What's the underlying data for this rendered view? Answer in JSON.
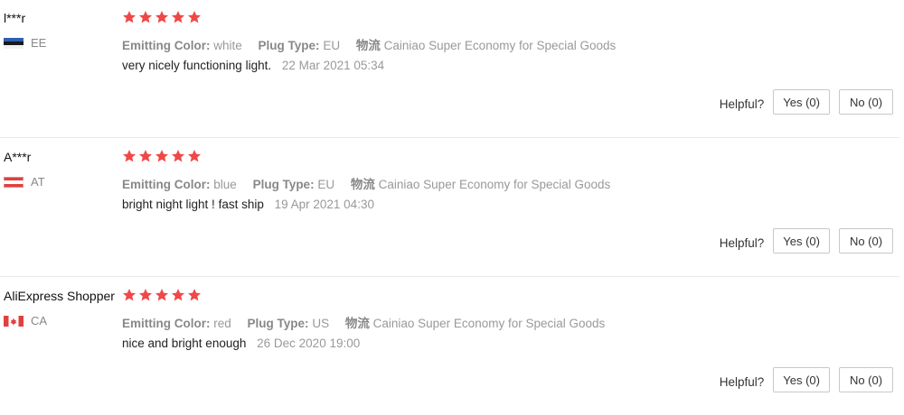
{
  "labels": {
    "emitting_color": "Emitting Color:",
    "plug_type": "Plug Type:",
    "logistics": "物流",
    "helpful": "Helpful?"
  },
  "colors": {
    "star": "#f04848",
    "muted_text": "#999999",
    "divider": "#e8e8e8"
  },
  "reviews": [
    {
      "user": "l***r",
      "country": "EE",
      "flag": "flag-ee-icon",
      "rating": 5,
      "emitting_color": "white",
      "plug_type": "EU",
      "logistics": "Cainiao Super Economy for Special Goods",
      "feedback": "very nicely functioning light.",
      "date": "22 Mar 2021 05:34",
      "yes_label": "Yes (0)",
      "no_label": "No (0)"
    },
    {
      "user": "A***r",
      "country": "AT",
      "flag": "flag-at-icon",
      "rating": 5,
      "emitting_color": "blue",
      "plug_type": "EU",
      "logistics": "Cainiao Super Economy for Special Goods",
      "feedback": "bright night light ! fast ship",
      "date": "19 Apr 2021 04:30",
      "yes_label": "Yes (0)",
      "no_label": "No (0)"
    },
    {
      "user": "AliExpress Shopper",
      "country": "CA",
      "flag": "flag-ca-icon",
      "rating": 5,
      "emitting_color": "red",
      "plug_type": "US",
      "logistics": "Cainiao Super Economy for Special Goods",
      "feedback": "nice and bright enough",
      "date": "26 Dec 2020 19:00",
      "yes_label": "Yes (0)",
      "no_label": "No (0)"
    }
  ]
}
